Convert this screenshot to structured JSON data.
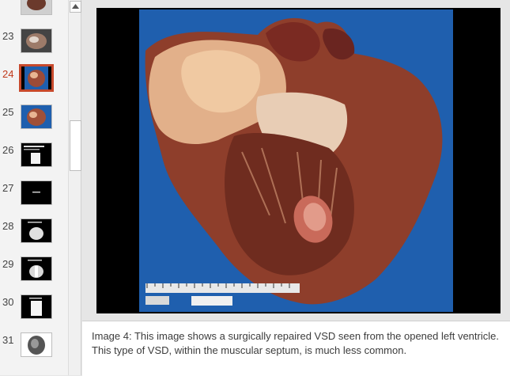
{
  "thumbnails": [
    {
      "number": "23"
    },
    {
      "number": "24"
    },
    {
      "number": "25"
    },
    {
      "number": "26"
    },
    {
      "number": "27"
    },
    {
      "number": "28"
    },
    {
      "number": "29"
    },
    {
      "number": "30"
    },
    {
      "number": "31"
    }
  ],
  "selected_slide": "24",
  "notes": {
    "text": "Image 4: This image shows a surgically repaired VSD seen from the opened left ventricle.  This type of VSD, within the muscular septum, is much less common."
  },
  "colors": {
    "selection_border": "#c7492c",
    "photo_background": "#1f5fae"
  }
}
